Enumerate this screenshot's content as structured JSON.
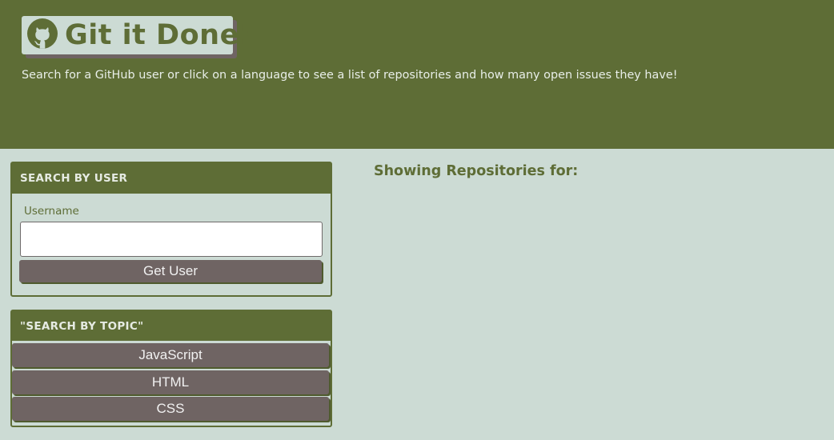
{
  "header": {
    "title": "Git it Done!",
    "logo_icon": "github-icon",
    "subtitle": "Search for a GitHub user or click on a language to see a list of repositories and how many open issues they have!"
  },
  "user_search": {
    "heading": "SEARCH BY USER",
    "username_label": "Username",
    "username_value": "",
    "button_label": "Get User"
  },
  "topic_search": {
    "heading": "\"SEARCH BY TOPIC\"",
    "topics": [
      "JavaScript",
      "HTML",
      "CSS"
    ]
  },
  "results": {
    "heading": "Showing Repositories for:"
  },
  "colors": {
    "primary": "#5e6d36",
    "background": "#ccdbd4",
    "button": "#6f6463"
  }
}
